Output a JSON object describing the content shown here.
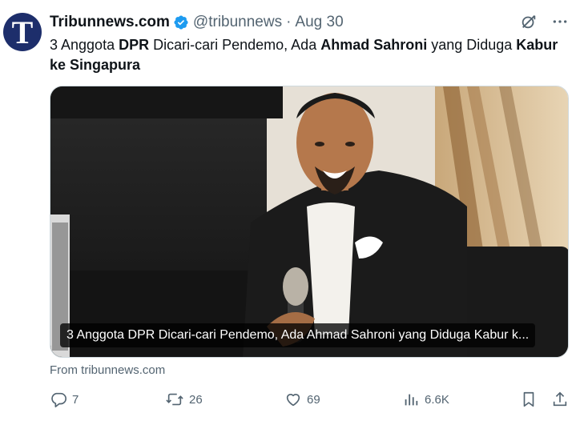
{
  "account": {
    "name": "Tribunnews.com",
    "handle": "@tribunnews",
    "separator": "·",
    "date": "Aug 30",
    "avatar_letter": "T",
    "verified_color": "#1d9bf0"
  },
  "tweet": {
    "text_parts": [
      {
        "text": "3 Anggota ",
        "bold": false
      },
      {
        "text": "DPR",
        "bold": true
      },
      {
        "text": " Dicari-cari Pendemo, Ada ",
        "bold": false
      },
      {
        "text": "Ahmad Sahroni",
        "bold": true
      },
      {
        "text": " yang Diduga ",
        "bold": false
      },
      {
        "text": "Kabur ke Singapura",
        "bold": true
      }
    ]
  },
  "card": {
    "caption": "3 Anggota DPR Dicari-cari Pendemo, Ada Ahmad Sahroni yang Diduga Kabur k..."
  },
  "source": "From tribunnews.com",
  "actions": {
    "replies": "7",
    "reposts": "26",
    "likes": "69",
    "views": "6.6K"
  },
  "icons": [
    "verified-badge-icon",
    "grok-icon",
    "more-icon",
    "reply-icon",
    "repost-icon",
    "like-icon",
    "views-icon",
    "bookmark-icon",
    "share-icon"
  ]
}
